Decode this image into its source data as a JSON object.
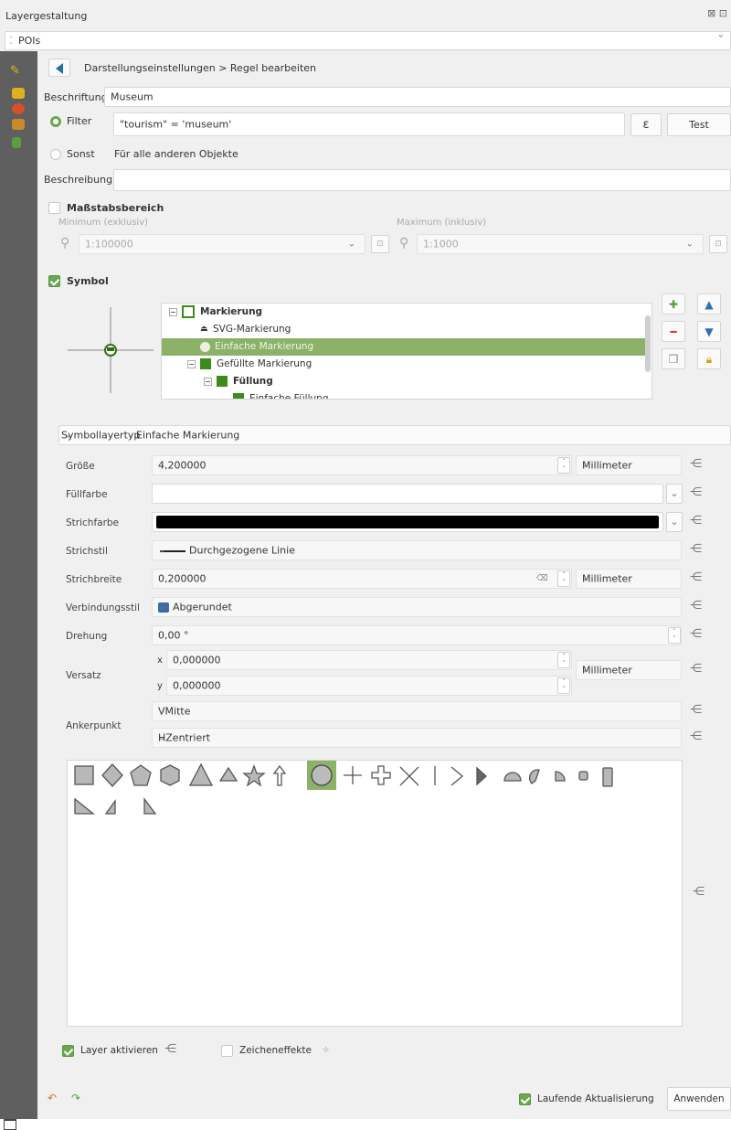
{
  "window": {
    "title": "Layergestaltung",
    "title_icons": "⊠ ⊡"
  },
  "layer_selector": {
    "icon": "⁚",
    "value": "POIs"
  },
  "breadcrumb": {
    "text": "Darstellungseinstellungen > Regel bearbeiten"
  },
  "rule": {
    "label_caption": "Beschriftung",
    "label_value": "Museum",
    "filter_caption": "Filter",
    "filter_value": "\"tourism\" = 'museum'",
    "expression_button": "ε",
    "test_button": "Test",
    "else_caption": "Sonst",
    "else_text": "Für alle anderen Objekte",
    "description_caption": "Beschreibung",
    "description_value": ""
  },
  "scale": {
    "title": "Maßstabsbereich",
    "min_caption": "Minimum (exklusiv)",
    "min_value": "1:100000",
    "max_caption": "Maximum (inklusiv)",
    "max_value": "1:1000"
  },
  "symbol": {
    "title": "Symbol",
    "tree": [
      {
        "label": "Markierung",
        "bold": true
      },
      {
        "label": "SVG-Markierung"
      },
      {
        "label": "Einfache Markierung",
        "selected": true
      },
      {
        "label": "Gefüllte Markierung"
      },
      {
        "label": "Füllung",
        "bold": true
      },
      {
        "label": "Einfache Füllung"
      }
    ]
  },
  "layer_type": {
    "caption": "Symbollayertyp",
    "value": "Einfache Markierung"
  },
  "properties": {
    "size_caption": "Größe",
    "size_value": "4,200000",
    "size_unit": "Millimeter",
    "fill_caption": "Füllfarbe",
    "fill_color": "#ffffff",
    "stroke_caption": "Strichfarbe",
    "stroke_color": "#000000",
    "style_caption": "Strichstil",
    "style_value": "Durchgezogene Linie",
    "width_caption": "Strichbreite",
    "width_value": "0,200000",
    "width_unit": "Millimeter",
    "join_caption": "Verbindungsstil",
    "join_value": "Abgerundet",
    "rotation_caption": "Drehung",
    "rotation_value": "0,00 °",
    "offset_caption": "Versatz",
    "offset_x_label": "x",
    "offset_x": "0,000000",
    "offset_y_label": "y",
    "offset_y": "0,000000",
    "offset_unit": "Millimeter",
    "anchor_caption": "Ankerpunkt",
    "anchor_v": "VMitte",
    "anchor_h": "HZentriert"
  },
  "shapes": [
    "square",
    "diamond",
    "pentagon",
    "hexagon",
    "triangle",
    "equilateral-triangle",
    "star",
    "arrow",
    "circle",
    "cross",
    "cross-fill",
    "x",
    "line",
    "arrowhead",
    "filled-arrowhead",
    "semi-circle",
    "third-circle",
    "quarter-circle",
    "quarter-square",
    "half-square",
    "right-half-triangle",
    "left-half-triangle",
    "diagonal-half-square"
  ],
  "footer": {
    "enable_layer": "Layer aktivieren",
    "draw_effects": "Zeicheneffekte",
    "live_update": "Laufende Aktualisierung",
    "apply": "Anwenden"
  },
  "colors": {
    "accent_green": "#6aa84f",
    "selection": "#8cb26a",
    "sidebar": "#5f5f5f"
  }
}
